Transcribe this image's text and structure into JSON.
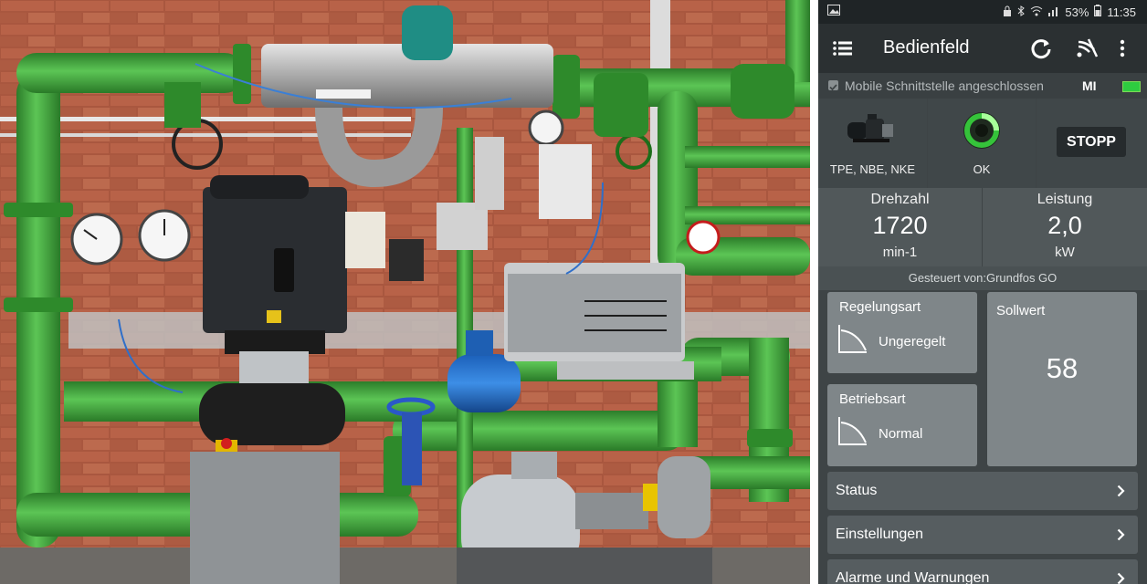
{
  "status_bar": {
    "battery_percent": "53%",
    "time": "11:35"
  },
  "app_bar": {
    "title": "Bedienfeld",
    "icons": [
      "menu-icon",
      "refresh-icon",
      "remote-icon",
      "more-vert-icon"
    ]
  },
  "connection": {
    "label": "Mobile Schnittstelle angeschlossen",
    "badge": "MI"
  },
  "pump": {
    "type_label": "TPE, NBE, NKE",
    "status_label": "OK",
    "stop_label": "STOPP"
  },
  "metrics": {
    "speed": {
      "label": "Drehzahl",
      "value": "1720",
      "unit": "min-1"
    },
    "power": {
      "label": "Leistung",
      "value": "2,0",
      "unit": "kW"
    }
  },
  "controlled_by": "Gesteuert von:Grundfos GO",
  "control_mode": {
    "title": "Regelungsart",
    "value": "Ungeregelt"
  },
  "operating_mode": {
    "title": "Betriebsart",
    "value": "Normal"
  },
  "setpoint": {
    "title": "Sollwert",
    "value": "58"
  },
  "nav": [
    {
      "label": "Status"
    },
    {
      "label": "Einstellungen"
    },
    {
      "label": "Alarme und Warnungen"
    }
  ],
  "colors": {
    "app_bg": "#3e4446",
    "card_bg": "#7f8689",
    "ok_green": "#35c33a",
    "pipe_green": "#3fa43a"
  }
}
